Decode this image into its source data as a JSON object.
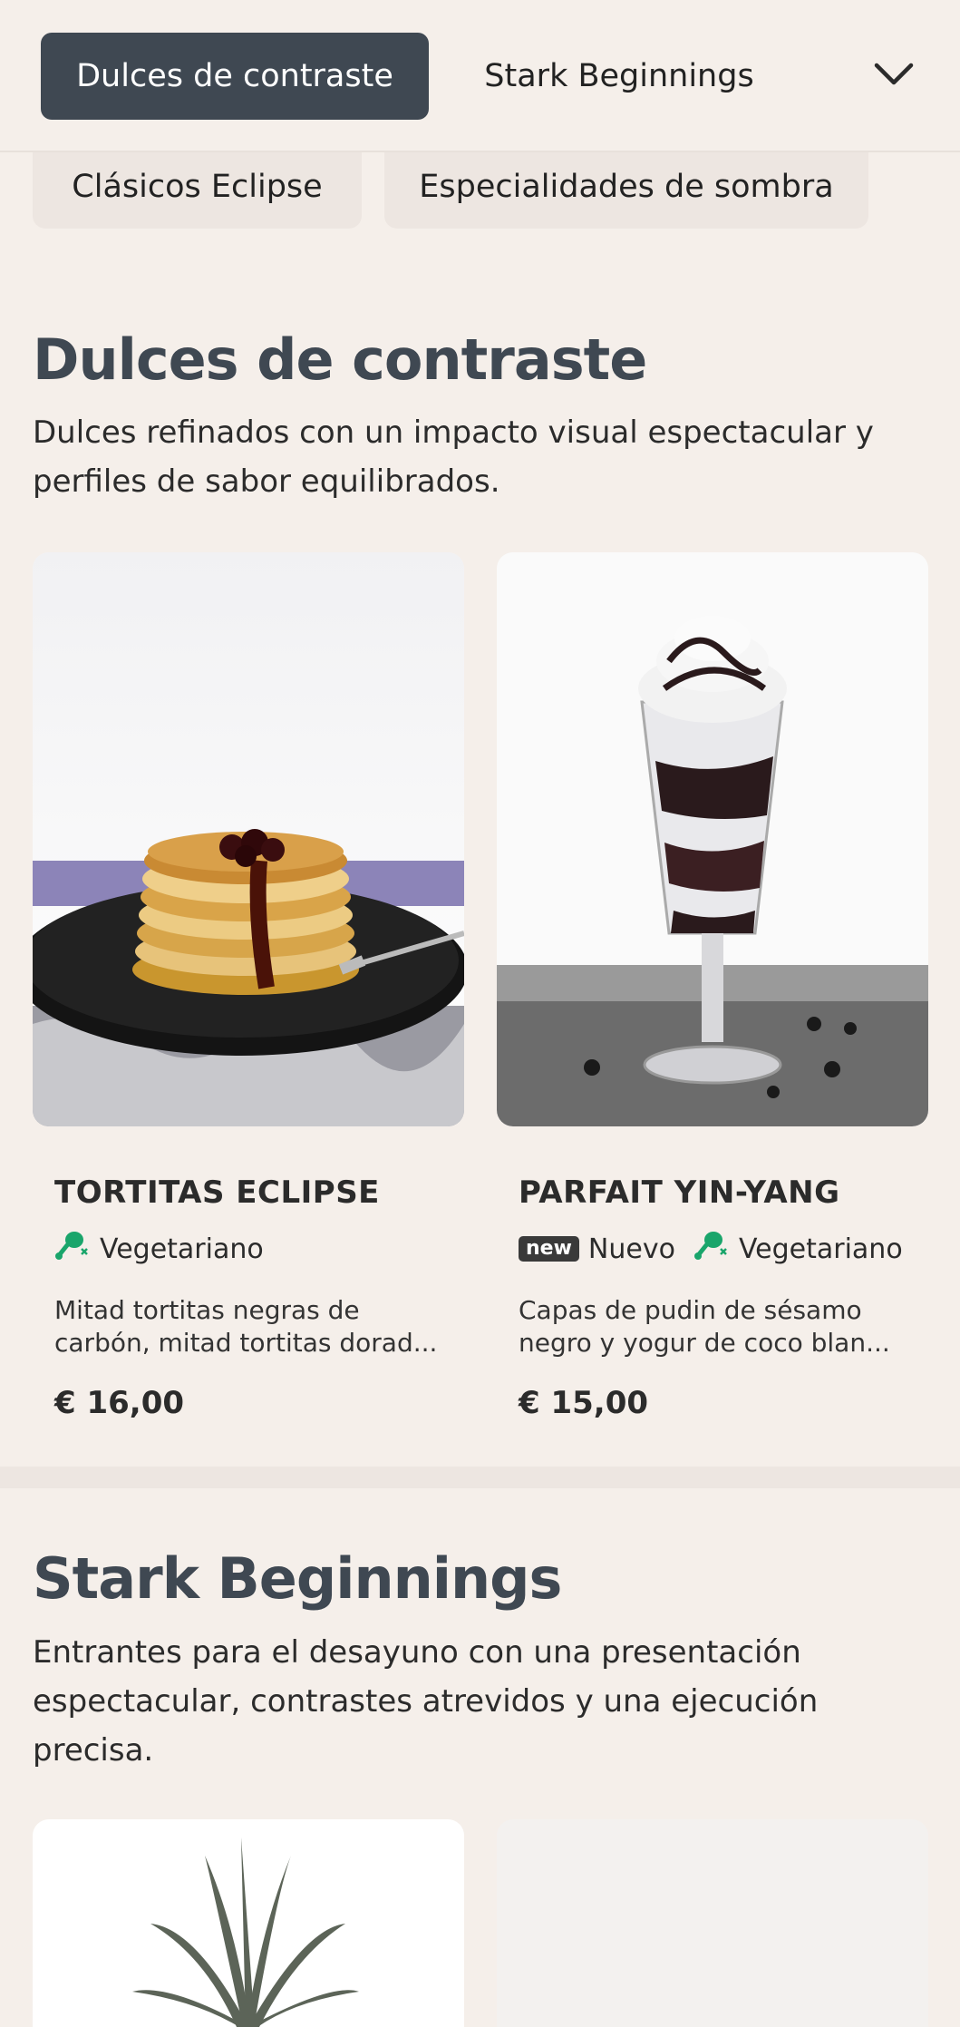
{
  "nav": {
    "active_tab": "Dulces de contraste",
    "tabs": [
      "Dulces de contraste",
      "Stark Beginnings"
    ],
    "expand_icon": "chevron-down-icon",
    "sub_tabs": [
      "Clásicos Eclipse",
      "Especialidades de sombra"
    ]
  },
  "sections": [
    {
      "title": "Dulces de contraste",
      "description": "Dulces refinados con un impacto visual espectacular y perfiles de sabor equilibrados.",
      "items": [
        {
          "name": "TORTITAS ECLIPSE",
          "is_new": false,
          "new_badge": "",
          "new_label": "",
          "diet_label": "Vegetariano",
          "diet_icon": "vegetarian-drumstick-icon",
          "description": "Mitad tortitas negras de carbón, mitad tortitas dorad...",
          "price": "€ 16,00",
          "image": "pancake-stack-photo"
        },
        {
          "name": "PARFAIT YIN-YANG",
          "is_new": true,
          "new_badge": "new",
          "new_label": "Nuevo",
          "diet_label": "Vegetariano",
          "diet_icon": "vegetarian-drumstick-icon",
          "description": "Capas de pudin de sésamo negro y yogur de coco blan...",
          "price": "€ 15,00",
          "image": "parfait-glass-photo"
        }
      ]
    },
    {
      "title": "Stark Beginnings",
      "description": "Entrantes para el desayuno con una presentación espectacular, contrastes atrevidos y una ejecución precisa.",
      "items": [
        {
          "image": "pineapple-photo"
        },
        {
          "image": "blank-photo"
        }
      ]
    }
  ],
  "colors": {
    "background": "#f5efea",
    "active_tab": "#3f4852",
    "heading": "#3f4852",
    "veg_green": "#1aa56b"
  }
}
